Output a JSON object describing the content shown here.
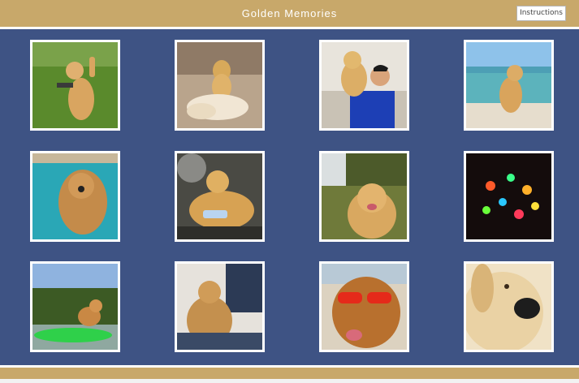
{
  "header": {
    "title": "Golden Memories",
    "instructions_label": "Instructions",
    "bar_color": "#c8a86a"
  },
  "background_color": "#3e5384",
  "photos": [
    {
      "subject": "golden retriever standing on hind legs on grass"
    },
    {
      "subject": "golden retriever sitting beside a pile of fur"
    },
    {
      "subject": "young man holding golden retriever"
    },
    {
      "subject": "golden retriever sitting on a beach"
    },
    {
      "subject": "golden retriever swimming in a pool"
    },
    {
      "subject": "golden retriever lying with a toy bottle"
    },
    {
      "subject": "smiling golden retriever near a waterfall"
    },
    {
      "subject": "colorful string lights in the dark"
    },
    {
      "subject": "golden retriever standing on a green kayak"
    },
    {
      "subject": "golden retriever lying on a blanket"
    },
    {
      "subject": "golden retriever wearing red sunglasses"
    },
    {
      "subject": "close-up of a golden retriever face"
    }
  ]
}
